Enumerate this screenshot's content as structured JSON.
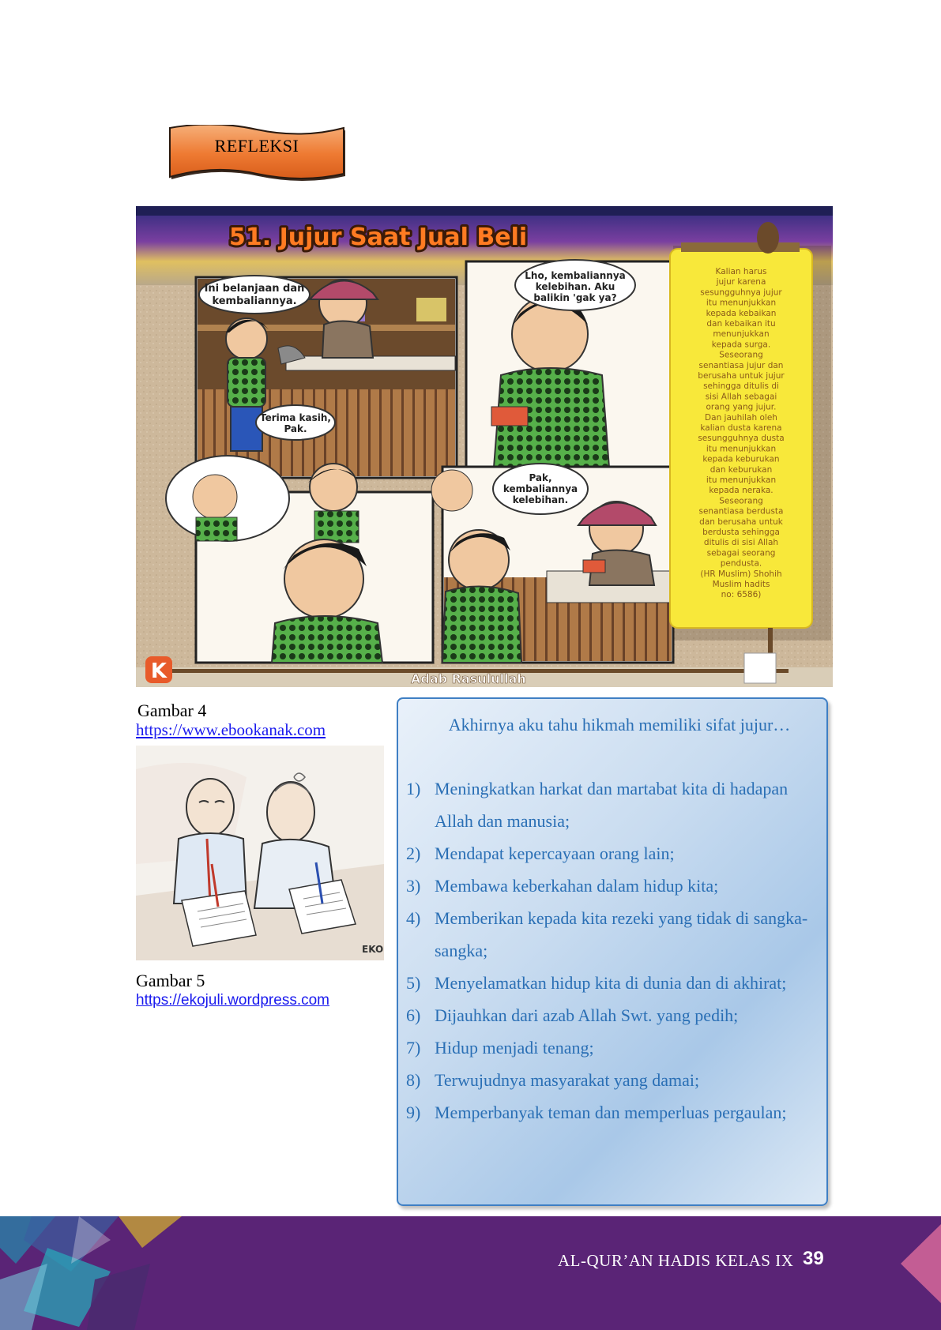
{
  "banner": {
    "label": "REFLEKSI"
  },
  "comic": {
    "header": "51. Jujur Saat Jual Beli",
    "footer": "Adab Rasulullah",
    "panel1_bubble1": [
      "Ini belanjaan dan",
      "kembaliannya."
    ],
    "panel1_bubble2": [
      "Terima kasih,",
      "Pak."
    ],
    "panel2_bubble": [
      "Lho, kembaliannya",
      "kelebihan. Aku",
      "balikin 'gak ya?"
    ],
    "panel4_bubble": [
      "Pak,",
      "kembaliannya",
      "kelebihan."
    ],
    "side_note": [
      "Kalian harus",
      "jujur karena",
      "sesungguhnya jujur",
      "itu menunjukkan",
      "kepada kebaikan",
      "dan kebaikan itu",
      "menunjukkan",
      "kepada surga.",
      "Seseorang",
      "senantiasa jujur dan",
      "berusaha untuk jujur",
      "sehingga ditulis di",
      "sisi Allah sebagai",
      "orang yang jujur.",
      "Dan jauhilah oleh",
      "kalian dusta karena",
      "sesungguhnya dusta",
      "itu menunjukkan",
      "kepada keburukan",
      "dan keburukan",
      "itu menunjukkan",
      "kepada neraka.",
      "Seseorang",
      "senantiasa berdusta",
      "dan berusaha untuk",
      "berdusta sehingga",
      "ditulis di sisi Allah",
      "sebagai seorang",
      "pendusta.",
      "(HR Muslim) Shohih",
      "Muslim hadits",
      "no: 6586)"
    ]
  },
  "figure4": {
    "caption": "Gambar 4",
    "link": "https://www.ebookanak.com"
  },
  "figure5": {
    "caption": "Gambar 5",
    "link": "https://ekojuli.wordpress.com"
  },
  "wisdom": {
    "intro": "Akhirnya aku tahu hikmah memiliki sifat jujur…",
    "items": [
      {
        "num": "1)",
        "text": "Meningkatkan harkat dan martabat kita di hadapan Allah dan manusia;"
      },
      {
        "num": "2)",
        "text": "Mendapat kepercayaan orang lain;"
      },
      {
        "num": "3)",
        "text": "Membawa keberkahan dalam hidup kita;"
      },
      {
        "num": "4)",
        "text": "Memberikan kepada kita rezeki yang tidak di sangka-sangka;"
      },
      {
        "num": "5)",
        "text": "Menyelamatkan hidup kita di dunia dan di akhirat;"
      },
      {
        "num": "6)",
        "text": "Dijauhkan dari azab Allah Swt. yang pedih;"
      },
      {
        "num": "7)",
        "text": "Hidup menjadi tenang;"
      },
      {
        "num": "8)",
        "text": "Terwujudnya masyarakat yang damai;"
      },
      {
        "num": "9)",
        "text": "Memperbanyak teman dan memperluas pergaulan;"
      }
    ]
  },
  "footer": {
    "title": "AL-QUR’AN HADIS KELAS IX",
    "page_number": "39"
  }
}
